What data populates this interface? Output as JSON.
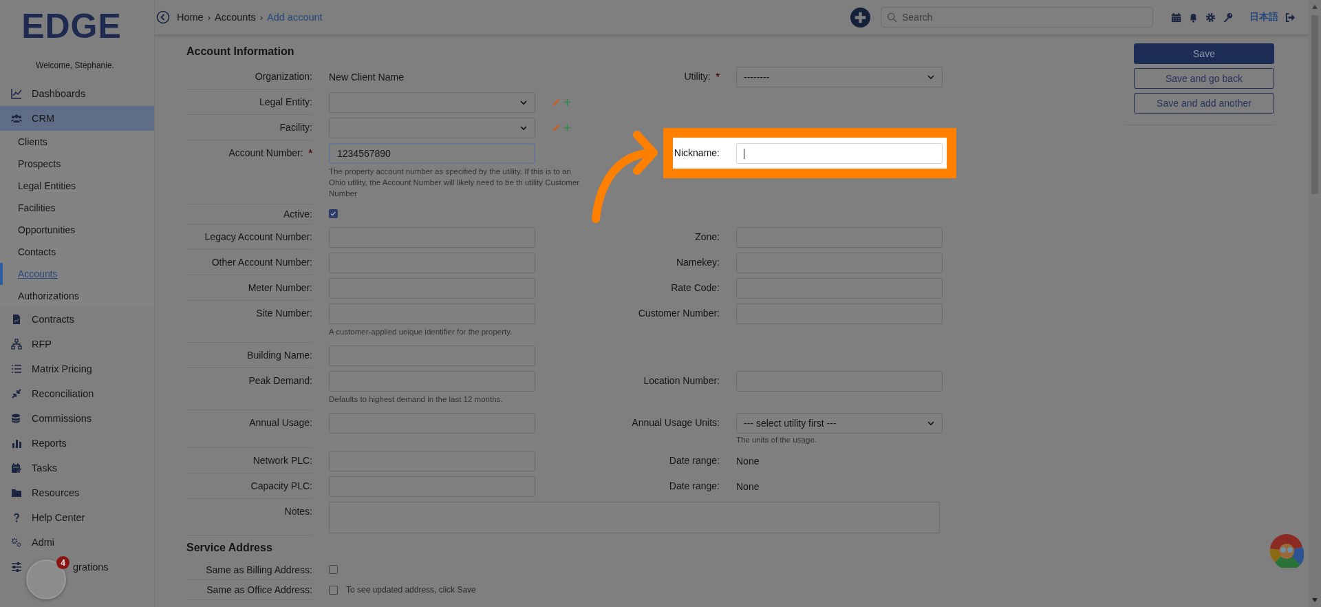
{
  "sidebar": {
    "logo": "EDGE",
    "welcome": "Welcome, Stephanie.",
    "items": [
      {
        "label": "Dashboards",
        "selected": false
      },
      {
        "label": "CRM",
        "selected": true,
        "children": [
          {
            "label": "Clients",
            "selected": false
          },
          {
            "label": "Prospects",
            "selected": false
          },
          {
            "label": "Legal Entities",
            "selected": false
          },
          {
            "label": "Facilities",
            "selected": false
          },
          {
            "label": "Opportunities",
            "selected": false
          },
          {
            "label": "Contacts",
            "selected": false
          },
          {
            "label": "Accounts",
            "selected": true
          },
          {
            "label": "Authorizations",
            "selected": false
          }
        ]
      },
      {
        "label": "Contracts",
        "selected": false
      },
      {
        "label": "RFP",
        "selected": false
      },
      {
        "label": "Matrix Pricing",
        "selected": false
      },
      {
        "label": "Reconciliation",
        "selected": false
      },
      {
        "label": "Commissions",
        "selected": false
      },
      {
        "label": "Reports",
        "selected": false
      },
      {
        "label": "Tasks",
        "selected": false
      },
      {
        "label": "Resources",
        "selected": false
      },
      {
        "label": "Help Center",
        "selected": false
      },
      {
        "label": "Admi",
        "selected": false
      },
      {
        "label": "grations",
        "selected": false,
        "covered": true
      }
    ]
  },
  "welcome_widget": {
    "badge": "4"
  },
  "topbar": {
    "breadcrumb": [
      {
        "label": "Home",
        "current": false
      },
      {
        "separator": "›",
        "label": "Accounts",
        "current": false
      },
      {
        "separator": "›",
        "label": "Add account",
        "current": true
      }
    ],
    "search": {
      "placeholder": "Search"
    },
    "language": "日本語"
  },
  "form": {
    "sections": [
      {
        "title": "Account Information",
        "rows": [
          {
            "left": {
              "label": "Organization:",
              "kind": "text",
              "value": "New Client Name"
            },
            "right": {
              "label": "Utility:",
              "required_mark": "*",
              "kind": "select",
              "value": "--------"
            }
          },
          {
            "left": {
              "label": "Legal Entity:",
              "kind": "select",
              "has_actions": true
            }
          },
          {
            "left": {
              "label": "Facility:",
              "kind": "select",
              "has_actions": true
            }
          },
          {
            "left": {
              "label": "Account Number:",
              "required_mark": "*",
              "kind": "input",
              "value": "1234567890",
              "focused": true,
              "help": "The property account number as specified by the utility. If this is to an Ohio utility, the Account Number will likely need to be th utility Customer Number"
            },
            "right": {
              "label": "Nickname:",
              "kind": "input",
              "focused": true,
              "highlighted": true
            }
          },
          {
            "left": {
              "label": "Active:",
              "kind": "checkbox",
              "checked": true
            }
          },
          {
            "left": {
              "label": "Legacy Account Number:",
              "kind": "input"
            },
            "right": {
              "label": "Zone:",
              "kind": "input"
            }
          },
          {
            "left": {
              "label": "Other Account Number:",
              "kind": "input"
            },
            "right": {
              "label": "Namekey:",
              "kind": "input"
            }
          },
          {
            "left": {
              "label": "Meter Number:",
              "kind": "input"
            },
            "right": {
              "label": "Rate Code:",
              "kind": "input"
            }
          },
          {
            "left": {
              "label": "Site Number:",
              "kind": "input",
              "help": "A customer-applied unique identifier for the property."
            },
            "right": {
              "label": "Customer Number:",
              "kind": "input"
            }
          },
          {
            "left": {
              "label": "Building Name:",
              "kind": "input"
            }
          },
          {
            "left": {
              "label": "Peak Demand:",
              "kind": "input",
              "help": "Defaults to highest demand in the last 12 months."
            },
            "right": {
              "label": "Location Number:",
              "kind": "input"
            }
          },
          {
            "left": {
              "label": "Annual Usage:",
              "kind": "input"
            },
            "right": {
              "label": "Annual Usage Units:",
              "kind": "select",
              "value": "--- select utility first ---",
              "help": "The units of the usage."
            }
          },
          {
            "left": {
              "label": "Network PLC:",
              "kind": "input"
            },
            "right": {
              "label": "Date range:",
              "kind": "text",
              "value": "None"
            }
          },
          {
            "left": {
              "label": "Capacity PLC:",
              "kind": "input"
            },
            "right": {
              "label": "Date range:",
              "kind": "text",
              "value": "None"
            }
          },
          {
            "left": {
              "label": "Notes:",
              "kind": "textarea"
            }
          }
        ]
      },
      {
        "title": "Service Address",
        "rows": [
          {
            "left": {
              "label": "Same as Billing Address:",
              "kind": "checkbox",
              "checked": false
            }
          },
          {
            "left": {
              "label": "Same as Office Address:",
              "kind": "checkbox",
              "checked": false,
              "note": "To see updated address, click Save"
            }
          }
        ]
      }
    ]
  },
  "actions": [
    {
      "label": "Save",
      "primary": true
    },
    {
      "label": "Save and go back",
      "primary": false
    },
    {
      "label": "Save and add another",
      "primary": false
    }
  ]
}
